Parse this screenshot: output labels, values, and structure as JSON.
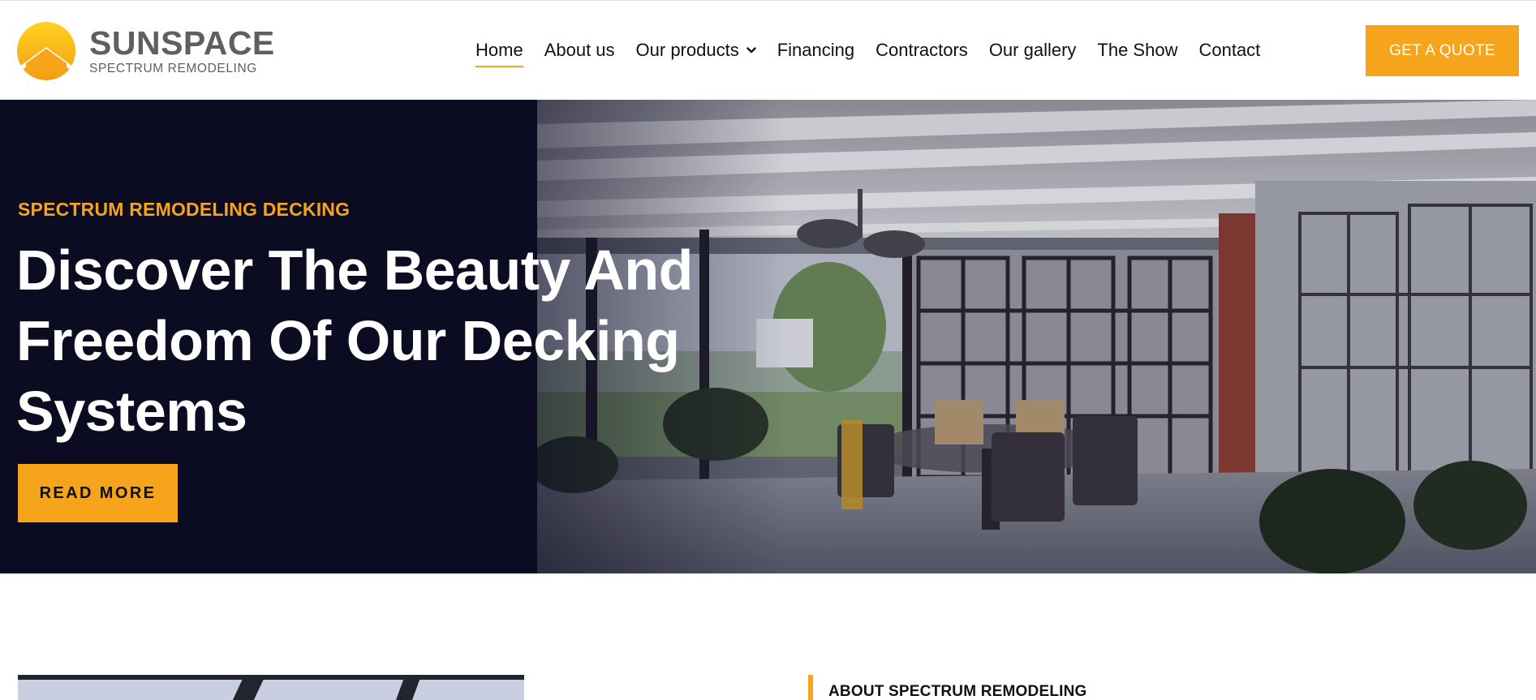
{
  "brand": {
    "name": "SUNSPACE",
    "tagline": "SPECTRUM REMODELING",
    "colors": {
      "accent": "#f6a41c",
      "hero_dark": "#0b0b22",
      "logo_gray": "#5f5f5f"
    }
  },
  "nav": {
    "items": [
      {
        "label": "Home",
        "active": true
      },
      {
        "label": "About us"
      },
      {
        "label": "Our products",
        "icon": "chevron-down-icon"
      },
      {
        "label": "Financing"
      },
      {
        "label": "Contractors"
      },
      {
        "label": "Our gallery"
      },
      {
        "label": "The Show"
      },
      {
        "label": "Contact"
      }
    ],
    "cta_label": "GET A QUOTE"
  },
  "hero": {
    "eyebrow": "SPECTRUM REMODELING DECKING",
    "title_lines": [
      "Discover The Beauty And",
      "Freedom Of Our Decking",
      "Systems"
    ],
    "button_label": "READ MORE"
  },
  "about": {
    "label": "ABOUT SPECTRUM REMODELING"
  }
}
